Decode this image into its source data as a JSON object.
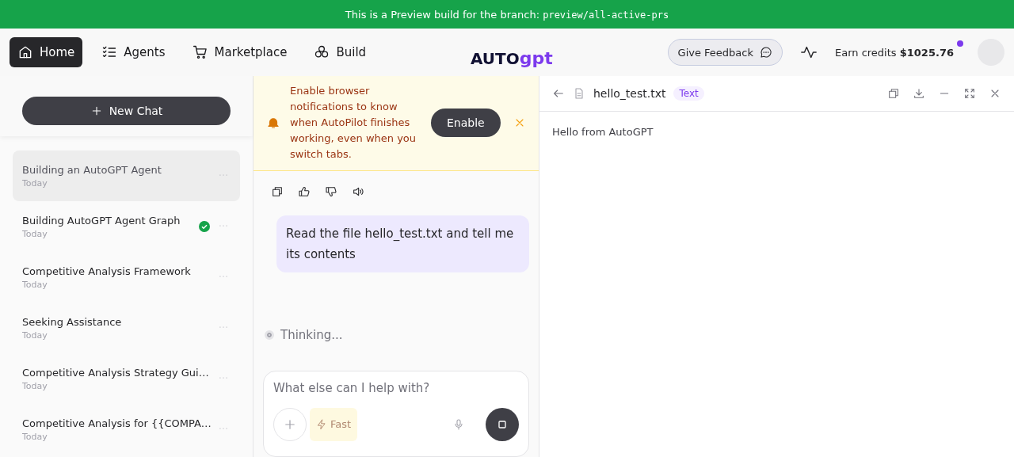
{
  "preview_banner": {
    "text": "This is a Preview build for the branch: ",
    "branch": "preview/all-active-prs"
  },
  "nav": [
    {
      "label": "Home",
      "selected": true
    },
    {
      "label": "Agents",
      "selected": false
    },
    {
      "label": "Marketplace",
      "selected": false
    },
    {
      "label": "Build",
      "selected": false
    }
  ],
  "logo": {
    "left": "AUTO",
    "right": "gpt"
  },
  "header": {
    "feedback": "Give Feedback",
    "credits_label": "Earn credits",
    "credits_value": "$1025.76",
    "credits_notification": true
  },
  "sidebar": {
    "new_chat": "New Chat",
    "chats": [
      {
        "title": "Building an AutoGPT Agent",
        "date": "Today",
        "selected": true,
        "completed": false
      },
      {
        "title": "Building AutoGPT Agent Graph",
        "date": "Today",
        "selected": false,
        "completed": true
      },
      {
        "title": "Competitive Analysis Framework",
        "date": "Today",
        "selected": false,
        "completed": false
      },
      {
        "title": "Seeking Assistance",
        "date": "Today",
        "selected": false,
        "completed": false
      },
      {
        "title": "Competitive Analysis Strategy Gui…",
        "date": "Today",
        "selected": false,
        "completed": false
      },
      {
        "title": "Competitive Analysis for {{COMPA…",
        "date": "Today",
        "selected": false,
        "completed": false
      }
    ]
  },
  "notice": {
    "text": "Enable browser notifications to know when AutoPilot finishes working, even when you switch tabs.",
    "button": "Enable"
  },
  "user_messages": [
    "Read the file hello_test.txt and tell me its contents"
  ],
  "status": "Thinking...",
  "composer": {
    "placeholder": "What else can I help with?",
    "mode": "Fast"
  },
  "file_panel": {
    "filename": "hello_test.txt",
    "type": "Text",
    "content": "Hello from AutoGPT"
  }
}
